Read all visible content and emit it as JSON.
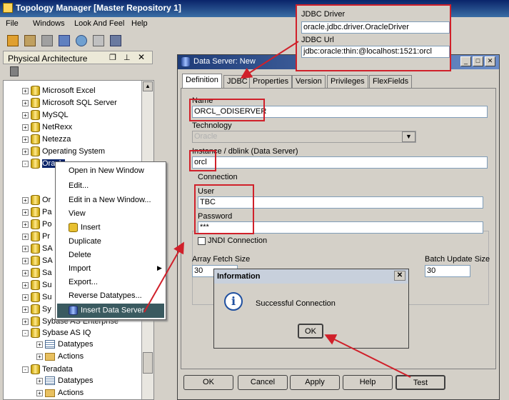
{
  "window": {
    "title": "Topology Manager [Master Repository 1]"
  },
  "menubar": {
    "items": [
      "File",
      "Windows",
      "Look And Feel",
      "Help"
    ]
  },
  "left_panel": {
    "title": "Physical Architecture",
    "tree": [
      "Microsoft Excel",
      "Microsoft SQL Server",
      "MySQL",
      "NetRexx",
      "Netezza",
      "Operating System",
      "Oracle",
      "Or",
      "Pa",
      "Po",
      "Pr",
      "SA",
      "SA",
      "Sa",
      "Su",
      "Su",
      "Sy",
      "Sybase AS Enterprise",
      "Sybase AS IQ",
      "Datatypes",
      "Actions",
      "Teradata",
      "Datatypes",
      "Actions"
    ]
  },
  "context_menu": {
    "items": [
      "Open in New Window",
      "Edit...",
      "Edit in a New Window...",
      "View",
      "Insert",
      "Duplicate",
      "Delete",
      "Import",
      "Export...",
      "Reverse Datatypes...",
      "Insert Data Server"
    ]
  },
  "dialog": {
    "title": "Data Server: New",
    "tabs": [
      "Definition",
      "JDBC",
      "Properties",
      "Version",
      "Privileges",
      "FlexFields"
    ],
    "name_label": "Name",
    "name_value": "ORCL_ODISERVER",
    "technology_label": "Technology",
    "technology_value": "Oracle",
    "instance_label": "Instance / dblink (Data Server)",
    "instance_value": "orcl",
    "connection_label": "Connection",
    "user_label": "User",
    "user_value": "TBC",
    "password_label": "Password",
    "password_value": "***",
    "jndi_label": "JNDI Connection",
    "array_fetch_label": "Array Fetch Size",
    "array_fetch_value": "30",
    "batch_update_label": "Batch Update Size",
    "batch_update_value": "30",
    "buttons": {
      "ok": "OK",
      "cancel": "Cancel",
      "apply": "Apply",
      "help": "Help",
      "test": "Test"
    }
  },
  "info_dialog": {
    "title": "Information",
    "message": "Successful Connection",
    "ok": "OK"
  },
  "jdbc_callout": {
    "driver_label": "JDBC Driver",
    "driver_value": "oracle.jdbc.driver.OracleDriver",
    "url_label": "JDBC Url",
    "url_value": "jdbc:oracle:thin:@localhost:1521:orcl"
  },
  "colors": {
    "annotation_red": "#d0202a",
    "title_blue": "#0a246a"
  }
}
